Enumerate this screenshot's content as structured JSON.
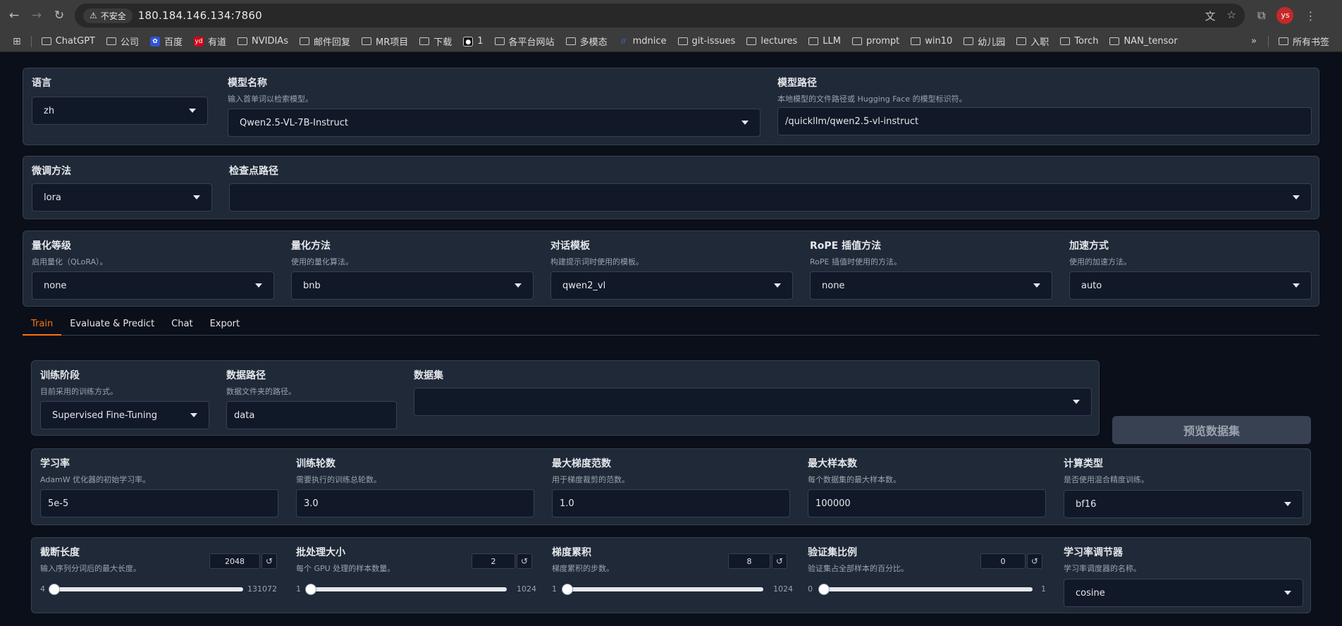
{
  "browser": {
    "security_label": "不安全",
    "url": "180.184.146.134:7860",
    "avatar": "ys",
    "bookmarks": [
      "ChatGPT",
      "公司",
      "百度",
      "有道",
      "NVIDIAs",
      "邮件回复",
      "MR项目",
      "下载",
      "1",
      "各平台网站",
      "多模态",
      "mdnice",
      "git-issues",
      "lectures",
      "LLM",
      "prompt",
      "win10",
      "幼儿园",
      "入职",
      "Torch",
      "NAN_tensor"
    ],
    "all_bookmarks": "所有书签"
  },
  "top": {
    "lang": {
      "label": "语言",
      "value": "zh"
    },
    "model_name": {
      "label": "模型名称",
      "info": "输入首单词以检索模型。",
      "value": "Qwen2.5-VL-7B-Instruct"
    },
    "model_path": {
      "label": "模型路径",
      "info": "本地模型的文件路径或 Hugging Face 的模型标识符。",
      "value": "/quickllm/qwen2.5-vl-instruct"
    }
  },
  "finetune": {
    "method": {
      "label": "微调方法",
      "value": "lora"
    },
    "checkpoint": {
      "label": "检查点路径",
      "value": ""
    }
  },
  "advanced": {
    "quant_bit": {
      "label": "量化等级",
      "info": "启用量化（QLoRA）。",
      "value": "none"
    },
    "quant_method": {
      "label": "量化方法",
      "info": "使用的量化算法。",
      "value": "bnb"
    },
    "template": {
      "label": "对话模板",
      "info": "构建提示词时使用的模板。",
      "value": "qwen2_vl"
    },
    "rope": {
      "label": "RoPE 插值方法",
      "info": "RoPE 插值时使用的方法。",
      "value": "none"
    },
    "booster": {
      "label": "加速方式",
      "info": "使用的加速方法。",
      "value": "auto"
    }
  },
  "tabs": [
    "Train",
    "Evaluate & Predict",
    "Chat",
    "Export"
  ],
  "train": {
    "stage": {
      "label": "训练阶段",
      "info": "目前采用的训练方式。",
      "value": "Supervised Fine-Tuning"
    },
    "dataset_dir": {
      "label": "数据路径",
      "info": "数据文件夹的路径。",
      "value": "data"
    },
    "dataset": {
      "label": "数据集",
      "value": ""
    },
    "preview_button": "预览数据集",
    "learning_rate": {
      "label": "学习率",
      "info": "AdamW 优化器的初始学习率。",
      "value": "5e-5"
    },
    "epochs": {
      "label": "训练轮数",
      "info": "需要执行的训练总轮数。",
      "value": "3.0"
    },
    "max_grad_norm": {
      "label": "最大梯度范数",
      "info": "用于梯度裁剪的范数。",
      "value": "1.0"
    },
    "max_samples": {
      "label": "最大样本数",
      "info": "每个数据集的最大样本数。",
      "value": "100000"
    },
    "compute_type": {
      "label": "计算类型",
      "info": "是否使用混合精度训练。",
      "value": "bf16"
    },
    "cutoff_len": {
      "label": "截断长度",
      "info": "输入序列分词后的最大长度。",
      "value": "2048",
      "min": "4",
      "max": "131072",
      "fraction": 0.015
    },
    "batch_size": {
      "label": "批处理大小",
      "info": "每个 GPU 处理的样本数量。",
      "value": "2",
      "min": "1",
      "max": "1024",
      "fraction": 0.001
    },
    "grad_accum": {
      "label": "梯度累积",
      "info": "梯度累积的步数。",
      "value": "8",
      "min": "1",
      "max": "1024",
      "fraction": 0.007
    },
    "val_size": {
      "label": "验证集比例",
      "info": "验证集占全部样本的百分比。",
      "value": "0",
      "min": "0",
      "max": "1",
      "fraction": 0
    },
    "lr_scheduler": {
      "label": "学习率调节器",
      "info": "学习率调度器的名称。",
      "value": "cosine"
    }
  }
}
